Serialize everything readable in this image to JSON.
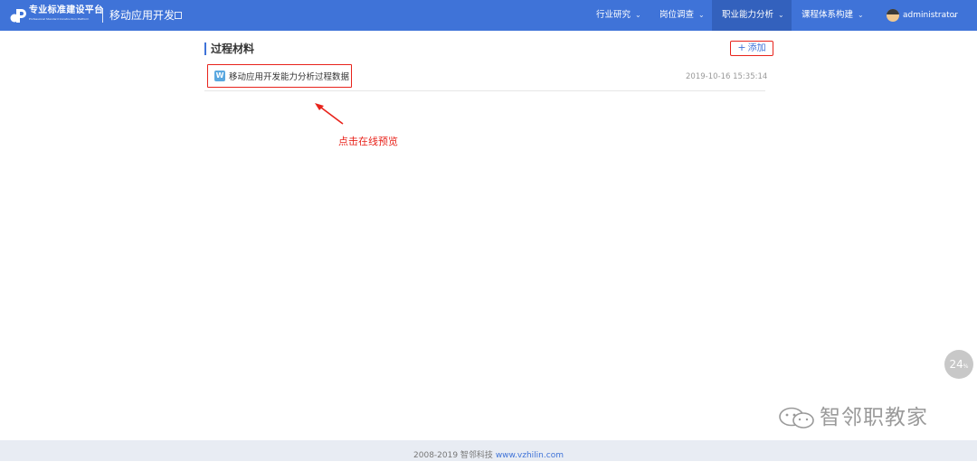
{
  "header": {
    "brand_title": "专业标准建设平台",
    "brand_subtitle": "Professional Standard Construction Platform",
    "project_name": "移动应用开发",
    "nav": [
      {
        "label": "行业研究",
        "active": false
      },
      {
        "label": "岗位调查",
        "active": false
      },
      {
        "label": "职业能力分析",
        "active": true
      },
      {
        "label": "课程体系构建",
        "active": false
      }
    ],
    "user_name": "administrator",
    "colors": {
      "bar": "#3f73d8",
      "active": "#3361bd"
    }
  },
  "section": {
    "title": "过程材料",
    "add_label": "添加"
  },
  "files": [
    {
      "icon": "W",
      "name": "移动应用开发能力分析过程数据",
      "time": "2019-10-16 15:35:14"
    }
  ],
  "annotation": {
    "text": "点击在线预览",
    "color": "#e8231b"
  },
  "badge": {
    "value": "24",
    "unit": "%"
  },
  "watermark": {
    "text": "智邻职教家"
  },
  "footer": {
    "copyright": "2008-2019 智邻科技",
    "link": "www.vzhilin.com"
  }
}
